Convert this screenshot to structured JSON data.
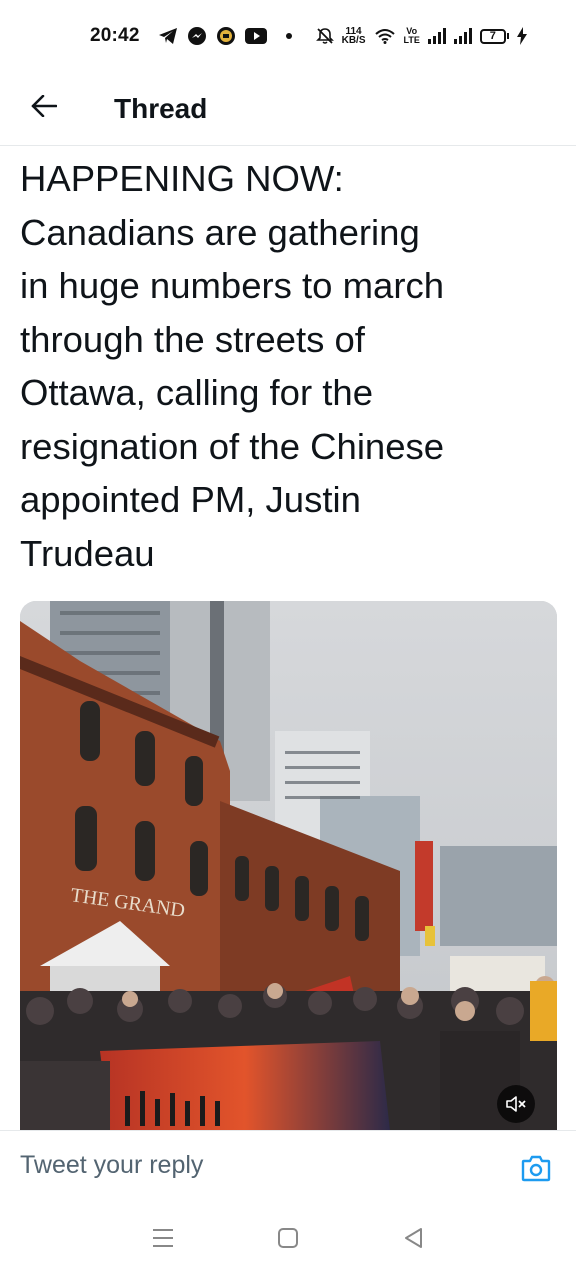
{
  "status_bar": {
    "time": "20:42",
    "net_speed_value": "114",
    "net_speed_unit": "KB/S",
    "volte_top": "Vo",
    "volte_bottom": "LTE",
    "battery_level": "7",
    "icons": [
      "telegram-icon",
      "messenger-icon",
      "notification-app-icon",
      "youtube-icon",
      "dot-icon",
      "mute-icon",
      "wifi-icon",
      "signal-icon",
      "signal-icon",
      "battery-icon",
      "charging-icon"
    ]
  },
  "header": {
    "title": "Thread",
    "back_icon": "arrow-left-icon"
  },
  "tweet": {
    "lines": [
      "HAPPENING NOW:",
      "Canadians are gathering",
      "in huge numbers to march",
      "through the streets of",
      "Ottawa, calling for the",
      "resignation of the Chinese",
      "appointed PM, Justin",
      "Trudeau"
    ],
    "media": {
      "sign_text": "THE GRAND",
      "mute_icon": "volume-muted-icon"
    }
  },
  "reply": {
    "placeholder": "Tweet your reply",
    "camera_icon": "camera-icon",
    "accent_color": "#1d9bf0"
  },
  "nav": {
    "icons": [
      "recent-apps-icon",
      "home-icon",
      "back-icon"
    ]
  }
}
